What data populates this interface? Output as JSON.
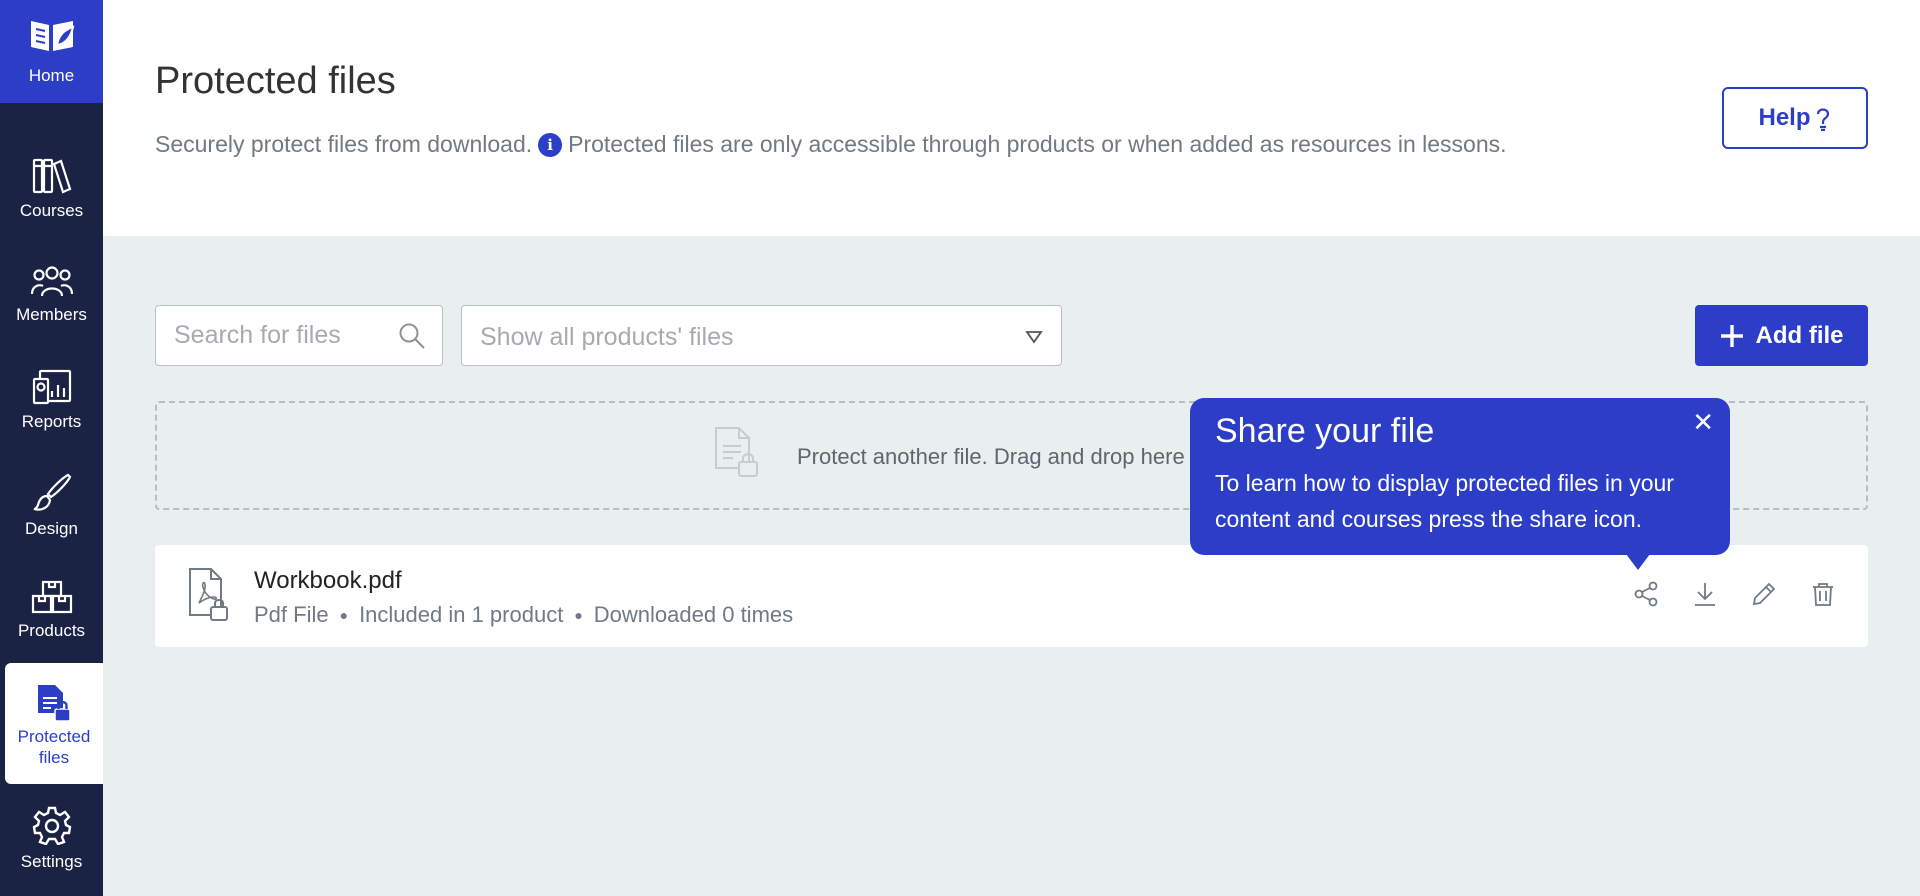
{
  "sidebar": {
    "items": [
      {
        "label": "Home",
        "icon": "book-leaf-icon"
      },
      {
        "label": "Courses",
        "icon": "library-icon"
      },
      {
        "label": "Members",
        "icon": "people-icon"
      },
      {
        "label": "Reports",
        "icon": "report-chart-icon"
      },
      {
        "label": "Design",
        "icon": "brush-icon"
      },
      {
        "label": "Products",
        "icon": "boxes-icon"
      },
      {
        "label": "Protected files",
        "icon": "locked-file-icon"
      },
      {
        "label": "Settings",
        "icon": "gear-icon"
      }
    ],
    "active": "Protected files"
  },
  "header": {
    "title": "Protected files",
    "subtitle_a": "Securely protect files from download.",
    "subtitle_b": "Protected files are only accessible through products or when added as resources in lessons.",
    "help_label": "Help"
  },
  "toolbar": {
    "search_placeholder": "Search for files",
    "filter_value": "Show all products' files",
    "add_label": "Add file"
  },
  "dropzone": {
    "text": "Protect another file. Drag and drop here"
  },
  "files": [
    {
      "name": "Workbook.pdf",
      "type": "Pdf File",
      "products": "Included in 1 product",
      "downloads": "Downloaded 0 times"
    }
  ],
  "tooltip": {
    "title": "Share your file",
    "body": "To learn how to display protected files in your content and courses press the share icon.",
    "close": "✕"
  },
  "colors": {
    "sidebar": "#1a2344",
    "accent": "#2c3ec8",
    "content_bg": "#e9eeee"
  }
}
